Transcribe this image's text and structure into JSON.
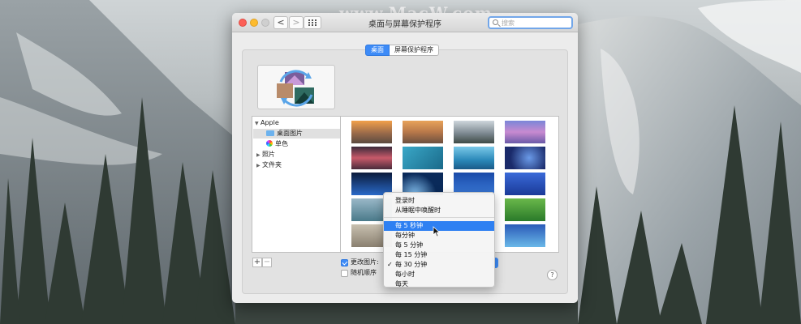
{
  "watermark": "www.MacW.com",
  "window": {
    "title": "桌面与屏幕保护程序",
    "search_placeholder": "搜索",
    "back_label": "<",
    "forward_label": ">"
  },
  "tabs": [
    {
      "label": "桌面",
      "active": true
    },
    {
      "label": "屏幕保护程序",
      "active": false
    }
  ],
  "sources": {
    "group": "Apple",
    "items": [
      {
        "label": "桌面图片",
        "icon": "folder-icon"
      },
      {
        "label": "单色",
        "icon": "color-wheel-icon"
      }
    ],
    "collapsed": [
      {
        "label": "照片"
      },
      {
        "label": "文件夹"
      }
    ]
  },
  "list_buttons": {
    "add": "+",
    "remove": "−"
  },
  "options": {
    "change_picture": {
      "label": "更改图片:",
      "checked": true
    },
    "random_order": {
      "label": "随机顺序",
      "checked": false
    }
  },
  "help_label": "?",
  "menu": {
    "items": [
      {
        "label": "登录时",
        "state": "normal"
      },
      {
        "label": "从睡眠中唤醒时",
        "state": "normal"
      },
      {
        "label": "每 5 秒钟",
        "state": "highlighted"
      },
      {
        "label": "每分钟",
        "state": "normal"
      },
      {
        "label": "每 5 分钟",
        "state": "normal"
      },
      {
        "label": "每 15 分钟",
        "state": "normal"
      },
      {
        "label": "每 30 分钟",
        "state": "checked"
      },
      {
        "label": "每小时",
        "state": "normal"
      },
      {
        "label": "每天",
        "state": "normal"
      }
    ],
    "check_mark": "✓"
  },
  "colors": {
    "accent": "#2e80f2",
    "close": "#fc5f57",
    "minimize": "#fdbb2e"
  }
}
